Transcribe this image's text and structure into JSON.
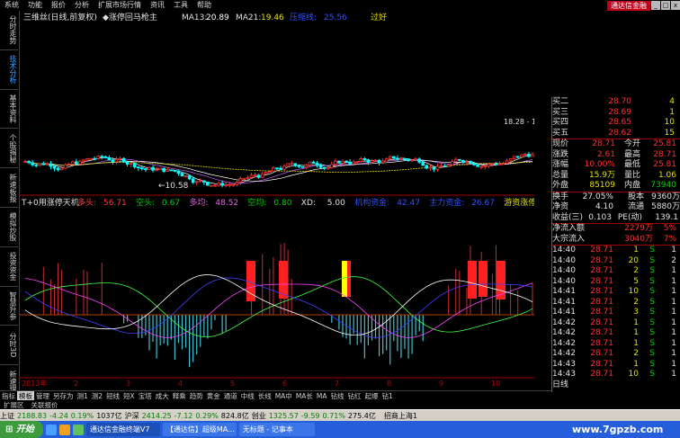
{
  "menu": {
    "items": [
      "系统",
      "功能",
      "报价",
      "分析",
      "扩展市场行情",
      "资讯",
      "工具",
      "帮助"
    ],
    "brand": "通达信金融",
    "window_controls": [
      "_",
      "□",
      "x"
    ]
  },
  "left_tabs": [
    "分时走势",
    "技术分析",
    "基本资料",
    "个股揭秘",
    "新速板报",
    "模拟炒股",
    "投资资金",
    "智慧升参",
    "分时3D",
    "新速理寥"
  ],
  "main_chart": {
    "title": "三维丝(日线,前复权)",
    "overlay_name": "◆涨停回马枪主",
    "ma13_label": "MA13:",
    "ma13_value": "20.89",
    "ma21_label": "MA21:",
    "ma21_value": "19.46",
    "extra_label": "压缩线:",
    "extra_value": "25.56",
    "corner_note": "过好",
    "low_marker": "←10.58",
    "high_note": "18.28 - 18."
  },
  "sub_chart": {
    "title": "T+0用涨停天机",
    "items": [
      {
        "label": "多头:",
        "value": "56.71",
        "color": "#ff3c3c"
      },
      {
        "label": "空头:",
        "value": "0.67",
        "color": "#00d000"
      },
      {
        "label": "多均:",
        "value": "48.52",
        "color": "#e060e0"
      },
      {
        "label": "空均:",
        "value": "0.80",
        "color": "#00d000"
      },
      {
        "label": "XD:",
        "value": "5.00",
        "color": "#e0e0e0"
      },
      {
        "label": "机构资金:",
        "value": "42.47",
        "color": "#3050ff"
      },
      {
        "label": "主力资金:",
        "value": "26.67",
        "color": "#3050ff"
      },
      {
        "label": "游资涨停资金:",
        "value": "0.0",
        "color": "#e0e000"
      }
    ],
    "year_label": "2013年",
    "month_labels": [
      "2",
      "3",
      "4",
      "5",
      "6",
      "7",
      "8",
      "9",
      "10"
    ]
  },
  "quote_panel": {
    "buy_rows": [
      {
        "label": "买二",
        "price": "28.70",
        "vol": "4"
      },
      {
        "label": "买三",
        "price": "28.69",
        "vol": "1"
      },
      {
        "label": "买四",
        "price": "28.65",
        "vol": "10"
      },
      {
        "label": "买五",
        "price": "28.62",
        "vol": "15"
      }
    ],
    "stat_rows": [
      {
        "l1": "现价",
        "v1": "28.71",
        "l2": "今开",
        "v2": "25.81"
      },
      {
        "l1": "涨跌",
        "v1": "2.61",
        "l2": "最高",
        "v2": "28.71"
      },
      {
        "l1": "涨幅",
        "v1": "10.00%",
        "l2": "最低",
        "v2": "25.81"
      },
      {
        "l1": "总量",
        "v1": "15.9万",
        "l2": "量比",
        "v2": "1.06"
      },
      {
        "l1": "外盘",
        "v1": "85109",
        "l2": "内盘",
        "v2": "73940"
      }
    ],
    "fund_rows": [
      {
        "l1": "换手",
        "v1": "27.05%",
        "l2": "股本",
        "v2": "9360万"
      },
      {
        "l1": "净资",
        "v1": "4.10",
        "l2": "流通",
        "v2": "5880万"
      },
      {
        "l1": "收益(三)",
        "v1": "0.103",
        "l2": "PE(动)",
        "v2": "139.1"
      }
    ],
    "flow_rows": [
      {
        "label": "净流入额",
        "value": "2279万",
        "pct": "5%"
      },
      {
        "label": "大宗流入",
        "value": "3040万",
        "pct": "7%"
      }
    ],
    "ticks": [
      {
        "time": "14:40",
        "price": "28.71",
        "vol": "1",
        "side": "S",
        "n": "1"
      },
      {
        "time": "14:40",
        "price": "28.71",
        "vol": "20",
        "side": "S",
        "n": "2"
      },
      {
        "time": "14:40",
        "price": "28.71",
        "vol": "2",
        "side": "S",
        "n": "1"
      },
      {
        "time": "14:40",
        "price": "28.71",
        "vol": "5",
        "side": "S",
        "n": "1"
      },
      {
        "time": "14:41",
        "price": "28.71",
        "vol": "10",
        "side": "S",
        "n": "1"
      },
      {
        "time": "14:41",
        "price": "28.71",
        "vol": "2",
        "side": "S",
        "n": "1"
      },
      {
        "time": "14:41",
        "price": "28.71",
        "vol": "3",
        "side": "S",
        "n": "1"
      },
      {
        "time": "14:42",
        "price": "28.71",
        "vol": "1",
        "side": "S",
        "n": "1"
      },
      {
        "time": "14:42",
        "price": "28.71",
        "vol": "1",
        "side": "S",
        "n": "1"
      },
      {
        "time": "14:42",
        "price": "28.71",
        "vol": "1",
        "side": "S",
        "n": "1"
      },
      {
        "time": "14:42",
        "price": "28.71",
        "vol": "2",
        "side": "S",
        "n": "1"
      },
      {
        "time": "14:43",
        "price": "28.71",
        "vol": "1",
        "side": "S",
        "n": "1"
      },
      {
        "time": "14:43",
        "price": "28.71",
        "vol": "10",
        "side": "S",
        "n": "1"
      }
    ],
    "footer_tab": "日线"
  },
  "bottom_tabs": [
    "指标",
    "模板",
    "管理",
    "另存为",
    "测1",
    "测2",
    "短线",
    "短X",
    "宝塔",
    "成大",
    "释乘",
    "趋势",
    "黄金",
    "通道",
    "中线",
    "长线",
    "MA中",
    "MA长",
    "MA",
    "钻线",
    "钻红",
    "起爆",
    "钻1"
  ],
  "sub_tabs": [
    "扩展区",
    "关联报价"
  ],
  "ticker": {
    "sh_label": "上证",
    "sh_value": "2188.83",
    "sh_change": "-4.24",
    "sh_pct": "0.19%",
    "sh_amount": "1037亿",
    "hs_label": "沪深",
    "hs_value": "2414.25",
    "hs_change": "-7.12",
    "hs_pct": "0.29%",
    "hs_amount": "824.8亿",
    "cy_label": "创业",
    "cy_value": "1325.57",
    "cy_change": "-9.59",
    "cy_pct": "0.71%",
    "cy_amount": "275.4亿",
    "news": "招商上海1"
  },
  "taskbar": {
    "start_label": "开始",
    "tasks": [
      "通达信金融终端V7",
      "【通达信】超级MA...",
      "无标题 - 记事本"
    ],
    "watermark": "www.7gpzb.com"
  },
  "colors": {
    "up": "#ff3030",
    "down": "#00ffff",
    "ma_white": "#ffffff",
    "ma_yellow": "#e0e000",
    "ma_purple": "#c060ff",
    "panel_gold": "#e0e000"
  }
}
